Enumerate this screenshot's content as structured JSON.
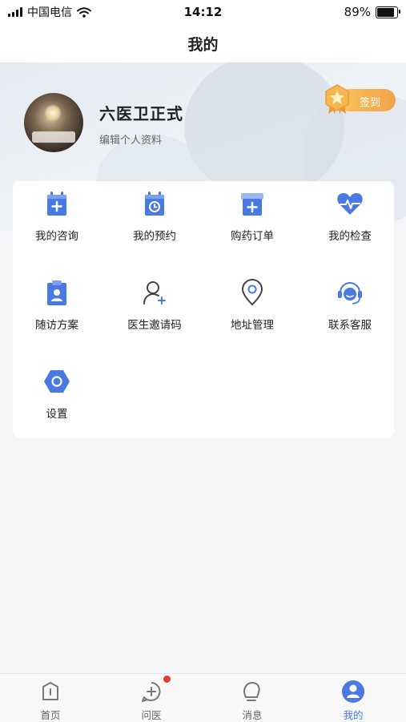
{
  "status_bar": {
    "carrier": "中国电信",
    "time": "14:12",
    "battery": "89%",
    "battery_level": 0.89
  },
  "nav": {
    "title": "我的"
  },
  "profile": {
    "name": "六医卫正式",
    "edit_label": "编辑个人资料",
    "signin_label": "签到"
  },
  "menu": {
    "items": [
      {
        "label": "我的咨询",
        "icon": "consult-icon"
      },
      {
        "label": "我的预约",
        "icon": "appointment-icon"
      },
      {
        "label": "购药订单",
        "icon": "medicine-order-icon"
      },
      {
        "label": "我的检查",
        "icon": "health-check-icon"
      },
      {
        "label": "随访方案",
        "icon": "follow-up-icon"
      },
      {
        "label": "医生邀请码",
        "icon": "doctor-invite-icon"
      },
      {
        "label": "地址管理",
        "icon": "location-icon"
      },
      {
        "label": "联系客服",
        "icon": "customer-service-icon"
      },
      {
        "label": "设置",
        "icon": "settings-icon"
      }
    ]
  },
  "tabs": [
    {
      "label": "首页",
      "icon": "home-icon",
      "active": false
    },
    {
      "label": "问医",
      "icon": "ask-doctor-icon",
      "active": false,
      "has_badge": true
    },
    {
      "label": "消息",
      "icon": "message-icon",
      "active": false
    },
    {
      "label": "我的",
      "icon": "profile-icon",
      "active": true
    }
  ],
  "colors": {
    "accent": "#4a79e3",
    "signin": "#f2a24a",
    "badge": "#e53935"
  }
}
